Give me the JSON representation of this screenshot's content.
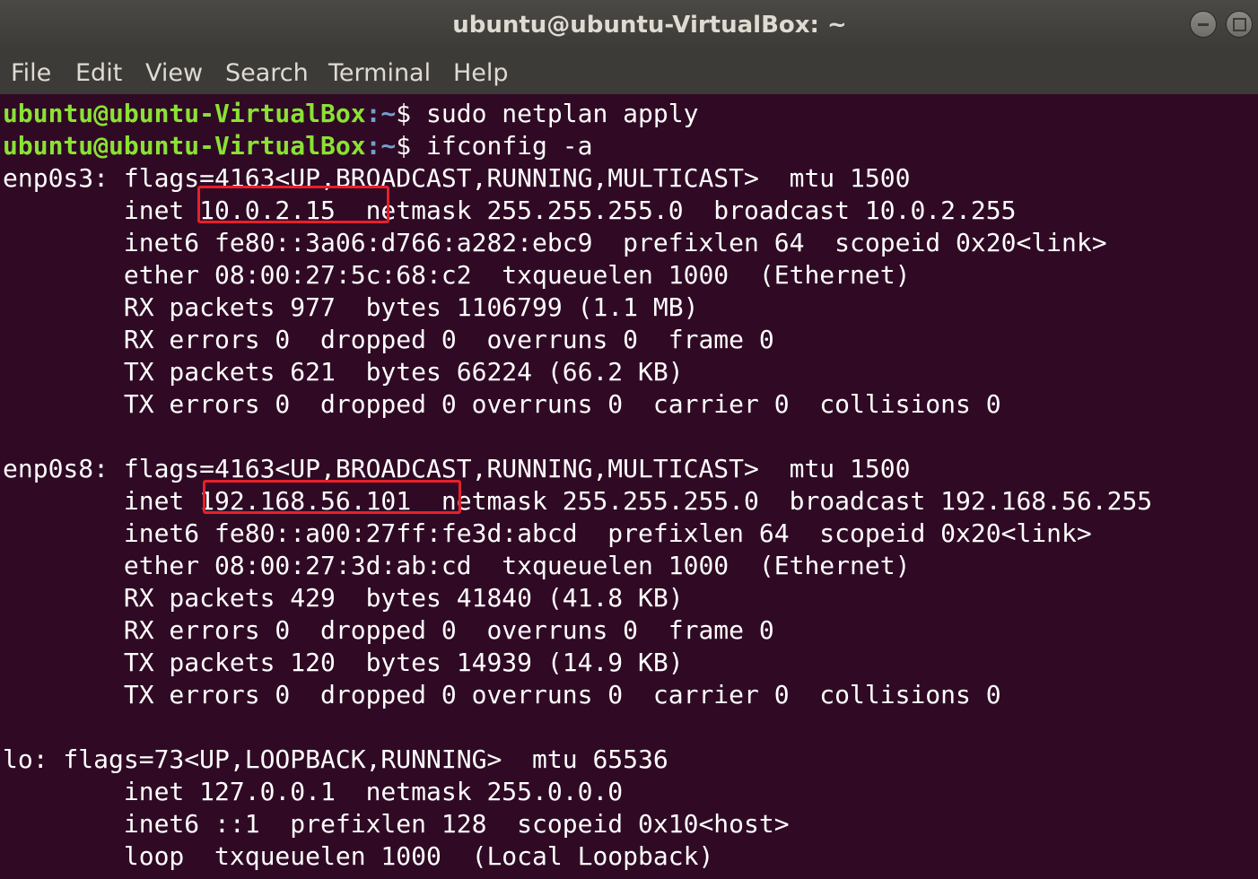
{
  "window": {
    "title": "ubuntu@ubuntu-VirtualBox: ~"
  },
  "menu": [
    {
      "label": "File"
    },
    {
      "label": "Edit"
    },
    {
      "label": "View"
    },
    {
      "label": "Search"
    },
    {
      "label": "Terminal"
    },
    {
      "label": "Help"
    }
  ],
  "terminal": {
    "prompt_user": "ubuntu@ubuntu-VirtualBox",
    "prompt_path": ":~",
    "prompt_symbol": "$ ",
    "commands": [
      "sudo netplan apply",
      "ifconfig -a"
    ],
    "output": [
      "enp0s3: flags=4163<UP,BROADCAST,RUNNING,MULTICAST>  mtu 1500",
      "        inet 10.0.2.15  netmask 255.255.255.0  broadcast 10.0.2.255",
      "        inet6 fe80::3a06:d766:a282:ebc9  prefixlen 64  scopeid 0x20<link>",
      "        ether 08:00:27:5c:68:c2  txqueuelen 1000  (Ethernet)",
      "        RX packets 977  bytes 1106799 (1.1 MB)",
      "        RX errors 0  dropped 0  overruns 0  frame 0",
      "        TX packets 621  bytes 66224 (66.2 KB)",
      "        TX errors 0  dropped 0 overruns 0  carrier 0  collisions 0",
      "",
      "enp0s8: flags=4163<UP,BROADCAST,RUNNING,MULTICAST>  mtu 1500",
      "        inet 192.168.56.101  netmask 255.255.255.0  broadcast 192.168.56.255",
      "        inet6 fe80::a00:27ff:fe3d:abcd  prefixlen 64  scopeid 0x20<link>",
      "        ether 08:00:27:3d:ab:cd  txqueuelen 1000  (Ethernet)",
      "        RX packets 429  bytes 41840 (41.8 KB)",
      "        RX errors 0  dropped 0  overruns 0  frame 0",
      "        TX packets 120  bytes 14939 (14.9 KB)",
      "        TX errors 0  dropped 0 overruns 0  carrier 0  collisions 0",
      "",
      "lo: flags=73<UP,LOOPBACK,RUNNING>  mtu 65536",
      "        inet 127.0.0.1  netmask 255.0.0.0",
      "        inet6 ::1  prefixlen 128  scopeid 0x10<host>",
      "        loop  txqueuelen 1000  (Local Loopback)"
    ]
  },
  "colors": {
    "terminal_bg": "#300a24",
    "prompt_user": "#8ae234",
    "prompt_path": "#729fcf",
    "highlight_box": "#e8202a"
  }
}
